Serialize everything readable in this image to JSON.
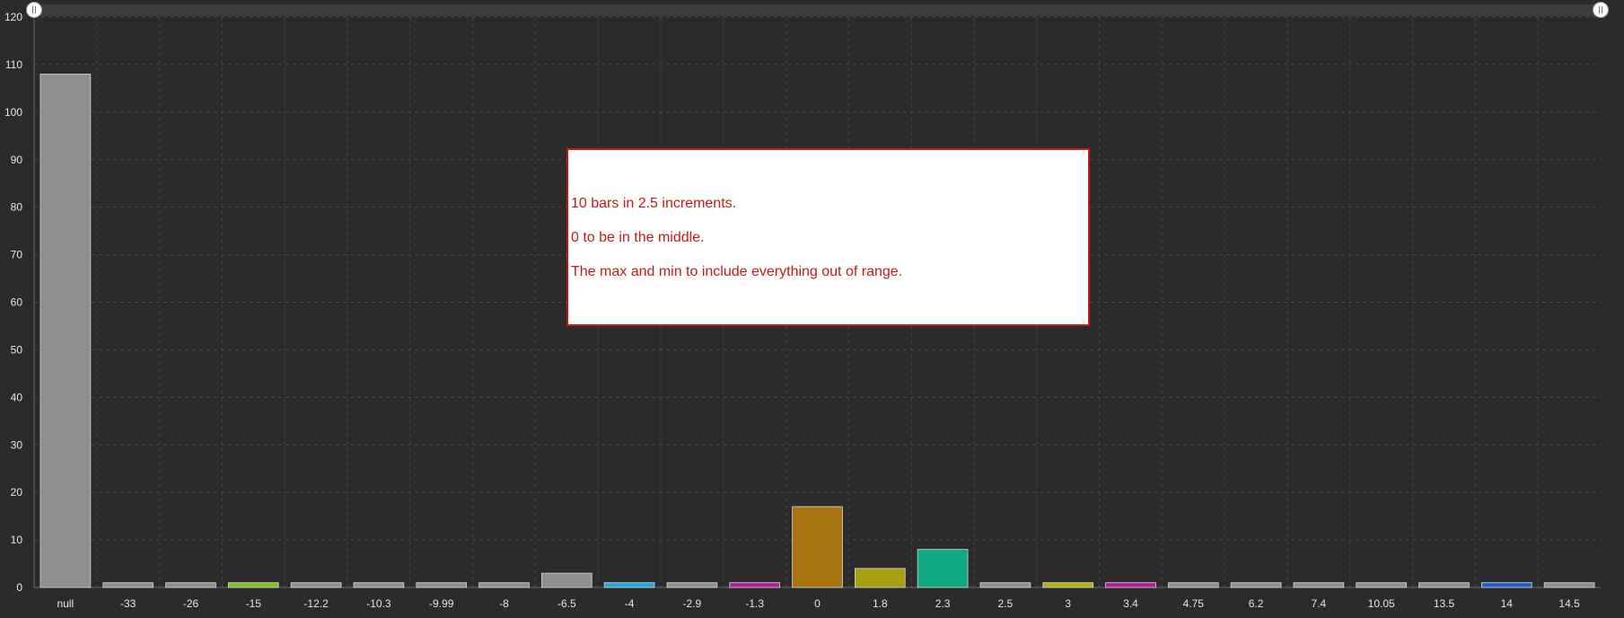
{
  "chart_data": {
    "type": "bar",
    "categories": [
      "null",
      "-33",
      "-26",
      "-15",
      "-12.2",
      "-10.3",
      "-9.99",
      "-8",
      "-6.5",
      "-4",
      "-2.9",
      "-1.3",
      "0",
      "1.8",
      "2.3",
      "2.5",
      "3",
      "3.4",
      "4.75",
      "6.2",
      "7.4",
      "10.05",
      "13.5",
      "14",
      "14.5"
    ],
    "values": [
      108,
      1,
      1,
      1,
      1,
      1,
      1,
      1,
      3,
      1,
      1,
      1,
      17,
      4,
      8,
      1,
      1,
      1,
      1,
      1,
      1,
      1,
      1,
      1,
      1
    ],
    "colors": [
      "#8f8f8f",
      "#8f8f8f",
      "#8f8f8f",
      "#7fbf1f",
      "#8f8f8f",
      "#8f8f8f",
      "#8f8f8f",
      "#8f8f8f",
      "#8f8f8f",
      "#1fa8d8",
      "#8f8f8f",
      "#b01fa0",
      "#a87410",
      "#a8a010",
      "#10a882",
      "#8f8f8f",
      "#b8b010",
      "#b01fa0",
      "#8f8f8f",
      "#8f8f8f",
      "#8f8f8f",
      "#8f8f8f",
      "#8f8f8f",
      "#1f5fc8",
      "#8f8f8f"
    ],
    "ylim": [
      0,
      120
    ],
    "yticks": [
      0,
      10,
      20,
      30,
      40,
      50,
      60,
      70,
      80,
      90,
      100,
      110,
      120
    ],
    "grid": true,
    "title": "",
    "xlabel": "",
    "ylabel": ""
  },
  "annotation": {
    "lines": [
      "10 bars in 2.5 increments.",
      "0 to be in the middle.",
      "The max and min to include everything out of range."
    ]
  }
}
